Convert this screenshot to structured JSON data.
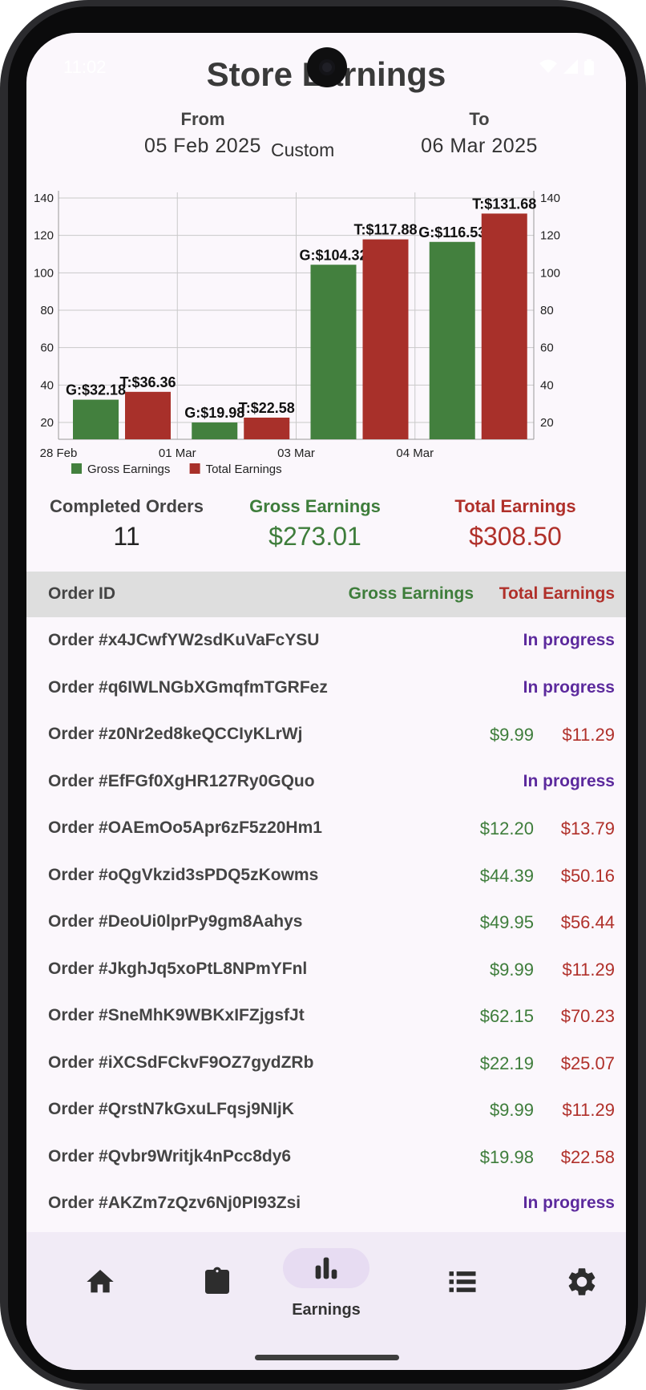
{
  "status_bar": {
    "time": "11:02"
  },
  "header": {
    "title": "Store Earnings"
  },
  "date_range": {
    "from_label": "From",
    "from_value": "05 Feb 2025",
    "mode": "Custom",
    "to_label": "To",
    "to_value": "06 Mar 2025"
  },
  "colors": {
    "gross": "#3e7d3b",
    "total": "#b0302a",
    "in_progress": "#5c2a9d",
    "bar_gross": "#43803e",
    "bar_total": "#a8302a"
  },
  "chart_data": {
    "type": "bar",
    "categories": [
      "28 Feb",
      "01 Mar",
      "03 Mar",
      "04 Mar"
    ],
    "series": [
      {
        "name": "Gross Earnings",
        "values": [
          32.18,
          19.98,
          104.32,
          116.53
        ],
        "labels": [
          "G:$32.18",
          "G:$19.98",
          "G:$104.32",
          "G:$116.53"
        ]
      },
      {
        "name": "Total Earnings",
        "values": [
          36.36,
          22.58,
          117.88,
          131.68
        ],
        "labels": [
          "T:$36.36",
          "T:$22.58",
          "T:$117.88",
          "T:$131.68"
        ]
      }
    ],
    "yticks": [
      20,
      40,
      60,
      80,
      100,
      120,
      140
    ],
    "ylim": [
      11,
      143
    ],
    "grid": true,
    "legend_position": "bottom-left",
    "secondary_y_axis": true
  },
  "summary": {
    "completed_label": "Completed Orders",
    "completed_value": "11",
    "gross_label": "Gross Earnings",
    "gross_value": "$273.01",
    "total_label": "Total Earnings",
    "total_value": "$308.50"
  },
  "table": {
    "headers": {
      "order_id": "Order ID",
      "gross": "Gross Earnings",
      "total": "Total Earnings"
    },
    "rows": [
      {
        "id": "Order #x4JCwfYW2sdKuVaFcYSU",
        "status": "In progress"
      },
      {
        "id": "Order #q6IWLNGbXGmqfmTGRFez",
        "status": "In progress"
      },
      {
        "id": "Order #z0Nr2ed8keQCCIyKLrWj",
        "gross": "$9.99",
        "total": "$11.29"
      },
      {
        "id": "Order #EfFGf0XgHR127Ry0GQuo",
        "status": "In progress"
      },
      {
        "id": "Order #OAEmOo5Apr6zF5z20Hm1",
        "gross": "$12.20",
        "total": "$13.79"
      },
      {
        "id": "Order #oQgVkzid3sPDQ5zKowms",
        "gross": "$44.39",
        "total": "$50.16"
      },
      {
        "id": "Order #DeoUi0lprPy9gm8Aahys",
        "gross": "$49.95",
        "total": "$56.44"
      },
      {
        "id": "Order #JkghJq5xoPtL8NPmYFnl",
        "gross": "$9.99",
        "total": "$11.29"
      },
      {
        "id": "Order #SneMhK9WBKxIFZjgsfJt",
        "gross": "$62.15",
        "total": "$70.23"
      },
      {
        "id": "Order #iXCSdFCkvF9OZ7gydZRb",
        "gross": "$22.19",
        "total": "$25.07"
      },
      {
        "id": "Order #QrstN7kGxuLFqsj9NIjK",
        "gross": "$9.99",
        "total": "$11.29"
      },
      {
        "id": "Order #Qvbr9Writjk4nPcc8dy6",
        "gross": "$19.98",
        "total": "$22.58"
      },
      {
        "id": "Order #AKZm7zQzv6Nj0PI93Zsi",
        "status": "In progress"
      }
    ]
  },
  "nav": {
    "items": [
      {
        "icon": "home-icon"
      },
      {
        "icon": "clipboard-icon"
      },
      {
        "icon": "bar-chart-icon",
        "label": "Earnings",
        "active": true
      },
      {
        "icon": "list-icon"
      },
      {
        "icon": "gear-icon"
      }
    ]
  }
}
